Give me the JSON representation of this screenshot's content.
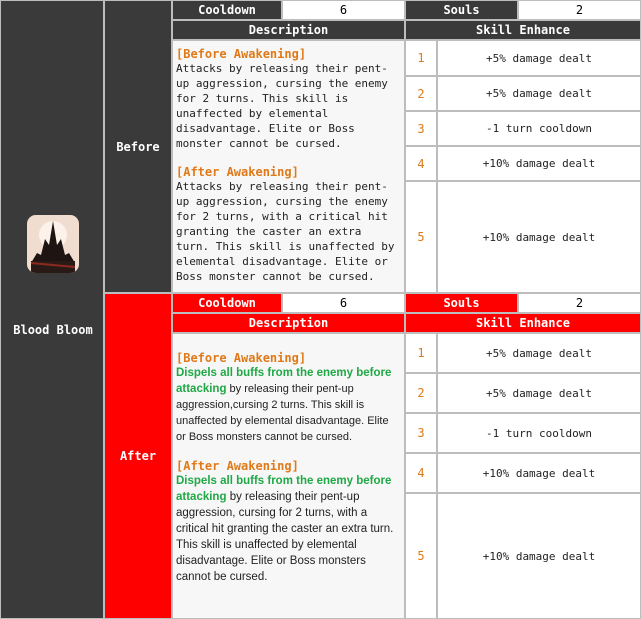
{
  "skill": {
    "name": "Blood Bloom"
  },
  "before": {
    "label": "Before",
    "cooldown_label": "Cooldown",
    "cooldown_value": "6",
    "souls_label": "Souls",
    "souls_value": "2",
    "description_label": "Description",
    "enhance_label": "Skill Enhance",
    "before_awakening_title": "[Before Awakening]",
    "before_awakening_text": "Attacks by releasing their pent-up aggression, cursing the enemy for 2 turns. This skill is unaffected by elemental disadvantage. Elite or Boss monster cannot be cursed.",
    "after_awakening_title": "[After Awakening]",
    "after_awakening_text": "Attacks by releasing their pent-up aggression, cursing the enemy for 2 turns, with a critical hit granting the caster an extra turn. This skill is unaffected by elemental disadvantage. Elite or Boss monster cannot be cursed.",
    "enhancements": [
      {
        "level": "1",
        "text": "+5% damage dealt"
      },
      {
        "level": "2",
        "text": "+5% damage dealt"
      },
      {
        "level": "3",
        "text": "-1 turn cooldown"
      },
      {
        "level": "4",
        "text": "+10% damage dealt"
      },
      {
        "level": "5",
        "text": "+10% damage dealt"
      }
    ]
  },
  "after": {
    "label": "After",
    "cooldown_label": "Cooldown",
    "cooldown_value": "6",
    "souls_label": "Souls",
    "souls_value": "2",
    "description_label": "Description",
    "enhance_label": "Skill Enhance",
    "before_awakening_title": "[Before Awakening]",
    "before_awakening_highlight": "Dispels all buffs from the enemy before attacking",
    "before_awakening_text": " by releasing their pent-up aggression,cursing 2 turns. This skill is unaffected by elemental disadvantage. Elite or Boss monsters cannot be cursed.",
    "after_awakening_title": "[After Awakening]",
    "after_awakening_highlight": "Dispels all buffs from the enemy before attacking",
    "after_awakening_text": " by releasing their pent-up aggression, cursing for 2 turns, with a critical hit granting the caster an extra turn. This skill is unaffected by elemental disadvantage. Elite or Boss monsters cannot be cursed.",
    "enhancements": [
      {
        "level": "1",
        "text": "+5% damage dealt"
      },
      {
        "level": "2",
        "text": "+5% damage dealt"
      },
      {
        "level": "3",
        "text": "-1 turn cooldown"
      },
      {
        "level": "4",
        "text": "+10% damage dealt"
      },
      {
        "level": "5",
        "text": "+10% damage dealt"
      }
    ]
  },
  "colors": {
    "dark": "#3a3a3a",
    "red": "#ff0000",
    "orange": "#e07a18",
    "green": "#1fa845"
  }
}
